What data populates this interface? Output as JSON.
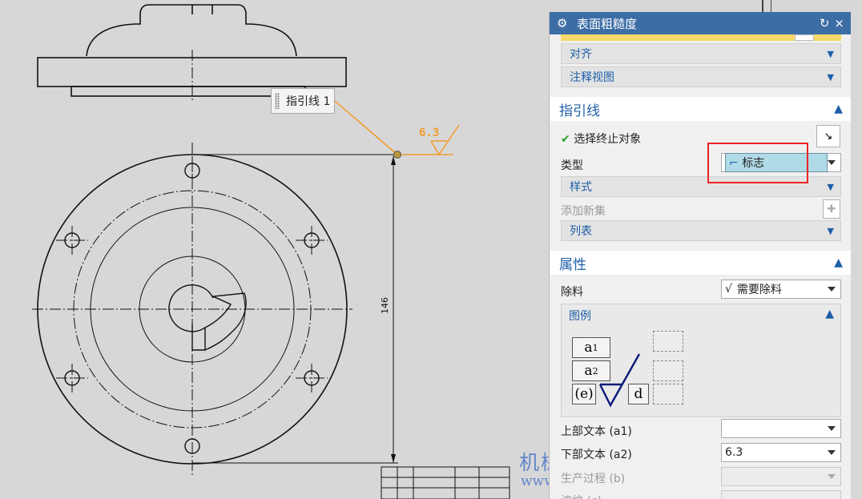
{
  "drawing": {
    "leader_label": "指引线 1",
    "roughness_value": "6.3",
    "dimension_value": "146",
    "watermark_cn": "机械时代网",
    "watermark_url": "www.jxage.com"
  },
  "panel": {
    "title": "表面粗糙度",
    "groups_top": [
      {
        "label": "对齐"
      },
      {
        "label": "注释视图"
      }
    ],
    "leader_section": {
      "title": "指引线",
      "select_end_label": "选择终止对象",
      "type_label": "类型",
      "type_value": "标志",
      "style_label": "样式",
      "add_set_label": "添加新集",
      "list_label": "列表"
    },
    "attributes_section": {
      "title": "属性",
      "material_label": "除料",
      "material_value": "需要除料",
      "legend_title": "图例",
      "legend_cells": {
        "a1": "a",
        "a1_sub": "1",
        "a2": "a",
        "a2_sub": "2",
        "e": "(e)",
        "d": "d"
      },
      "upper_text_label": "上部文本 (a1)",
      "upper_text_value": "",
      "lower_text_label": "下部文本 (a2)",
      "lower_text_value": "6.3",
      "process_label": "生产过程 (b)",
      "ripple_label": "波纹 (c)"
    }
  },
  "colors": {
    "panel_title_bg": "#3c6ea5",
    "accent_blue": "#1d5fa8",
    "highlight": "#b0dae6",
    "annotation_orange": "#f39a2a",
    "redbox": "#e22222"
  }
}
